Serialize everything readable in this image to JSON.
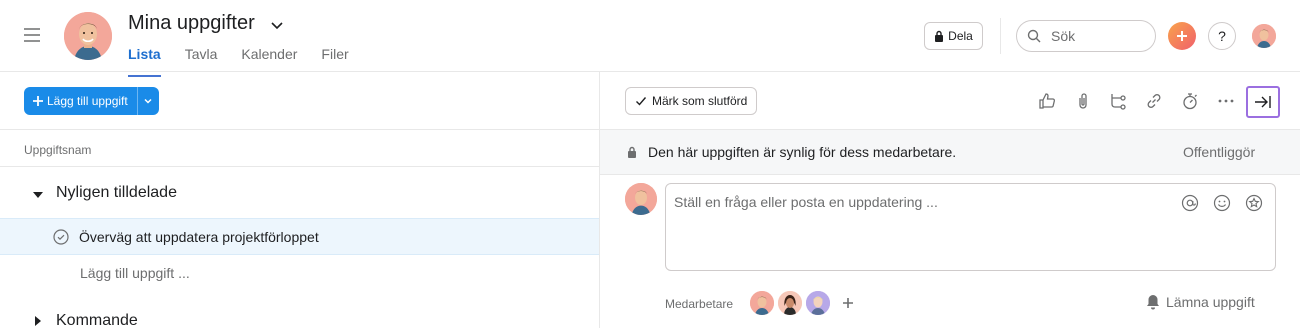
{
  "header": {
    "title": "Mina uppgifter",
    "tabs": [
      "Lista",
      "Tavla",
      "Kalender",
      "Filer"
    ],
    "active_tab": "Lista",
    "share_label": "Dela",
    "search_placeholder": "Sök",
    "help_label": "?"
  },
  "left": {
    "add_task_label": "Lägg till uppgift",
    "column_header": "Uppgiftsnam",
    "sections": [
      {
        "title": "Nyligen tilldelade",
        "expanded": true
      },
      {
        "title": "Kommande",
        "expanded": false
      }
    ],
    "tasks": [
      {
        "name": "Överväg att uppdatera projektförloppet",
        "selected": true
      }
    ],
    "add_subtask_label": "Lägg till uppgift ..."
  },
  "right": {
    "mark_complete_label": "Märk som slutförd",
    "toolbar_icons": [
      "like-icon",
      "attach-icon",
      "subtask-icon",
      "link-icon",
      "timer-icon",
      "more-icon",
      "close-pane-icon"
    ],
    "notice_text": "Den här uppgiften är synlig för dess medarbetare.",
    "publish_label": "Offentliggör",
    "comment_placeholder": "Ställ en fråga eller posta en uppdatering ...",
    "comment_icons": [
      "mention-icon",
      "emoji-icon",
      "appreciation-icon"
    ],
    "collaborators_label": "Medarbetare",
    "collaborator_count": 3,
    "leave_label": "Lämna uppgift"
  },
  "colors": {
    "accent_blue": "#1a8be8",
    "tab_underline": "#4573d2",
    "selected_row": "#edf6fd",
    "focus_outline": "#9b6fe0",
    "add_button_gradient": [
      "#f9a34b",
      "#f0606c"
    ]
  }
}
